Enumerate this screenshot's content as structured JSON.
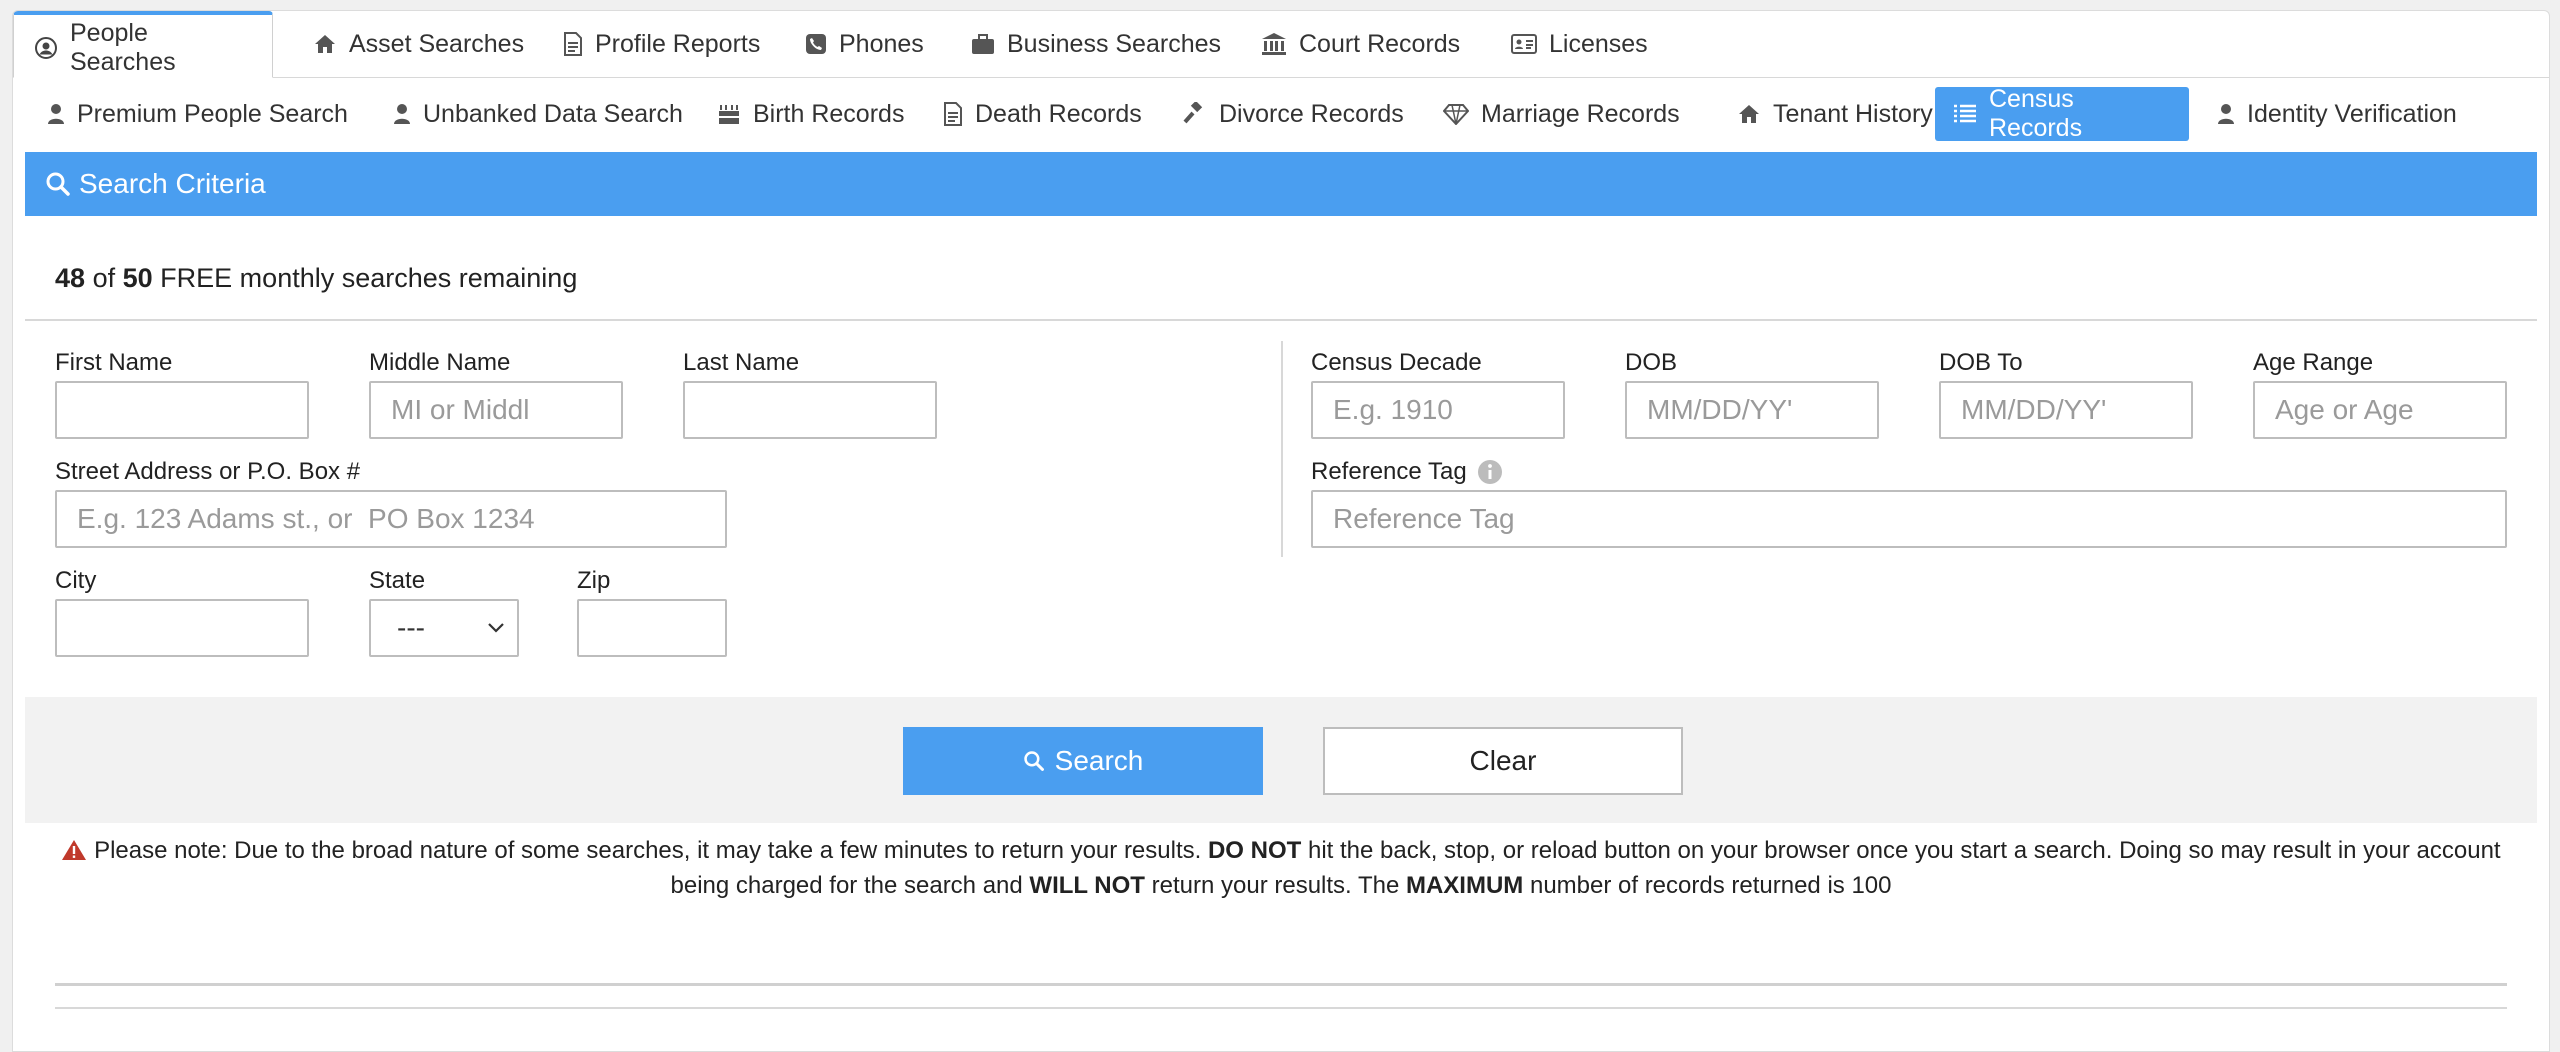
{
  "top_tabs": [
    {
      "label": "People Searches",
      "icon": "user-circle-icon",
      "active": true
    },
    {
      "label": "Asset Searches",
      "icon": "home-icon"
    },
    {
      "label": "Profile Reports",
      "icon": "document-icon"
    },
    {
      "label": "Phones",
      "icon": "phone-icon"
    },
    {
      "label": "Business Searches",
      "icon": "briefcase-icon"
    },
    {
      "label": "Court Records",
      "icon": "courthouse-icon"
    },
    {
      "label": "Licenses",
      "icon": "id-card-icon"
    }
  ],
  "sub_tabs": [
    {
      "label": "Premium People Search",
      "icon": "user-icon"
    },
    {
      "label": "Unbanked Data Search",
      "icon": "user-icon"
    },
    {
      "label": "Birth Records",
      "icon": "birthday-cake-icon"
    },
    {
      "label": "Death Records",
      "icon": "document-icon"
    },
    {
      "label": "Divorce Records",
      "icon": "gavel-icon"
    },
    {
      "label": "Marriage Records",
      "icon": "diamond-icon"
    },
    {
      "label": "Tenant History",
      "icon": "home-icon"
    },
    {
      "label": "Census Records",
      "icon": "list-icon",
      "active": true
    },
    {
      "label": "Identity Verification",
      "icon": "user-icon"
    }
  ],
  "criteria": {
    "title": "Search Criteria"
  },
  "remaining": {
    "used": "48",
    "of": "of",
    "total": "50",
    "text": "FREE monthly searches remaining"
  },
  "form": {
    "first_name": {
      "label": "First Name",
      "value": "",
      "placeholder": ""
    },
    "middle_name": {
      "label": "Middle Name",
      "value": "",
      "placeholder": "MI or Middl"
    },
    "last_name": {
      "label": "Last Name",
      "value": "",
      "placeholder": ""
    },
    "street": {
      "label": "Street Address or P.O. Box #",
      "placeholder": "E.g. 123 Adams st., or  PO Box 1234"
    },
    "city": {
      "label": "City",
      "placeholder": ""
    },
    "state": {
      "label": "State",
      "selected": "---"
    },
    "zip": {
      "label": "Zip",
      "placeholder": ""
    },
    "census_decade": {
      "label": "Census Decade",
      "placeholder": "E.g. 1910"
    },
    "dob": {
      "label": "DOB",
      "placeholder": "MM/DD/YY'"
    },
    "dob_to": {
      "label": "DOB To",
      "placeholder": "MM/DD/YY'"
    },
    "age_range": {
      "label": "Age Range",
      "placeholder": "Age or Age"
    },
    "reference_tag": {
      "label": "Reference Tag",
      "placeholder": "Reference Tag"
    }
  },
  "buttons": {
    "search": "Search",
    "clear": "Clear"
  },
  "note": {
    "p1": "Please note: Due to the broad nature of some searches, it may take a few minutes to return your results. ",
    "b1": "DO NOT",
    "p2": " hit the back, stop, or reload button on your browser once you start a search. Doing so may result in your account being charged for the search and ",
    "b2": "WILL NOT",
    "p3": " return your results. The ",
    "b3": "MAXIMUM",
    "p4": " number of records returned is 100"
  },
  "colors": {
    "accent": "#4a9ef0",
    "warning": "#c0392b"
  }
}
